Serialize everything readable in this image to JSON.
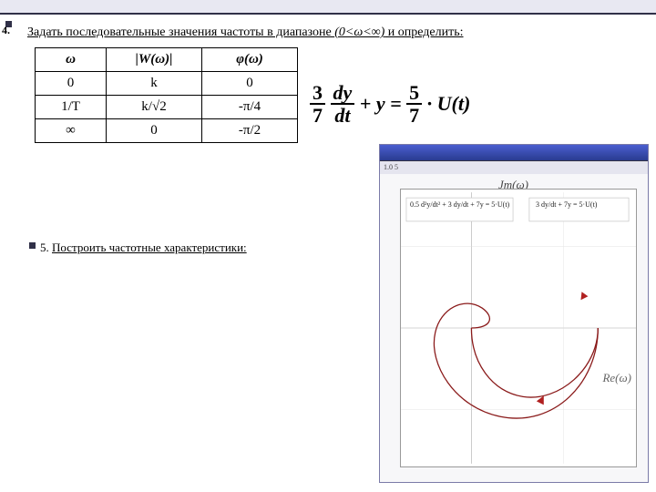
{
  "item4_num": "4.",
  "task4_prefix": "Задать последовательные значения частоты в диапазоне ",
  "task4_range": "(0<ω<∞)",
  "task4_suffix": " и определить:",
  "table": {
    "headers": {
      "c1": "ω",
      "c2": "|W(ω)|",
      "c3": "φ(ω)"
    },
    "rows": [
      {
        "c1": "0",
        "c2": "k",
        "c3": "0"
      },
      {
        "c1": "1/T",
        "c2": "k/√2",
        "c3": "-π/4"
      },
      {
        "c1": "∞",
        "c2": "0",
        "c3": "-π/2"
      }
    ]
  },
  "equation": {
    "f1n": "3",
    "f1d": "7",
    "dfn": "dy",
    "dfd": "dt",
    "plus": " + ",
    "yeq": "y  = ",
    "f2n": "5",
    "f2d": "7",
    "tail": " · U(t)"
  },
  "item5_num": "5.",
  "task5_text": "Построить частотные характеристики:",
  "inset": {
    "subbar": "1.0  5",
    "im_label": "Jm(ω)",
    "re_label": "Re(ω)",
    "anno_left": "0.5 d²y/dt² + 3 dy/dt + 7y = 5·U(t)",
    "anno_right": "3 dy/dt + 7y = 5·U(t)"
  },
  "chart_data": {
    "type": "line",
    "title": "Nyquist plot (frequency response)",
    "xlabel": "Re(ω)",
    "ylabel": "Jm(ω)",
    "xlim": [
      -0.4,
      0.9
    ],
    "ylim": [
      -0.6,
      0.6
    ],
    "series": [
      {
        "name": "3 dy/dt + 7y = 5·U(t)",
        "values": [
          [
            0.71,
            0.0
          ],
          [
            0.7,
            -0.1
          ],
          [
            0.66,
            -0.2
          ],
          [
            0.58,
            -0.29
          ],
          [
            0.46,
            -0.34
          ],
          [
            0.36,
            -0.36
          ],
          [
            0.24,
            -0.34
          ],
          [
            0.12,
            -0.27
          ],
          [
            0.04,
            -0.16
          ],
          [
            0.0,
            0.0
          ]
        ]
      },
      {
        "name": "0.5 d²y/dt² + 3 dy/dt + 7y = 5·U(t)",
        "values": [
          [
            0.71,
            0.0
          ],
          [
            0.69,
            -0.13
          ],
          [
            0.62,
            -0.26
          ],
          [
            0.5,
            -0.36
          ],
          [
            0.34,
            -0.42
          ],
          [
            0.16,
            -0.4
          ],
          [
            0.0,
            -0.32
          ],
          [
            -0.14,
            -0.2
          ],
          [
            -0.22,
            -0.06
          ],
          [
            -0.22,
            0.06
          ],
          [
            -0.14,
            0.16
          ],
          [
            0.0,
            0.16
          ],
          [
            0.08,
            0.08
          ],
          [
            0.0,
            0.0
          ]
        ]
      }
    ]
  }
}
